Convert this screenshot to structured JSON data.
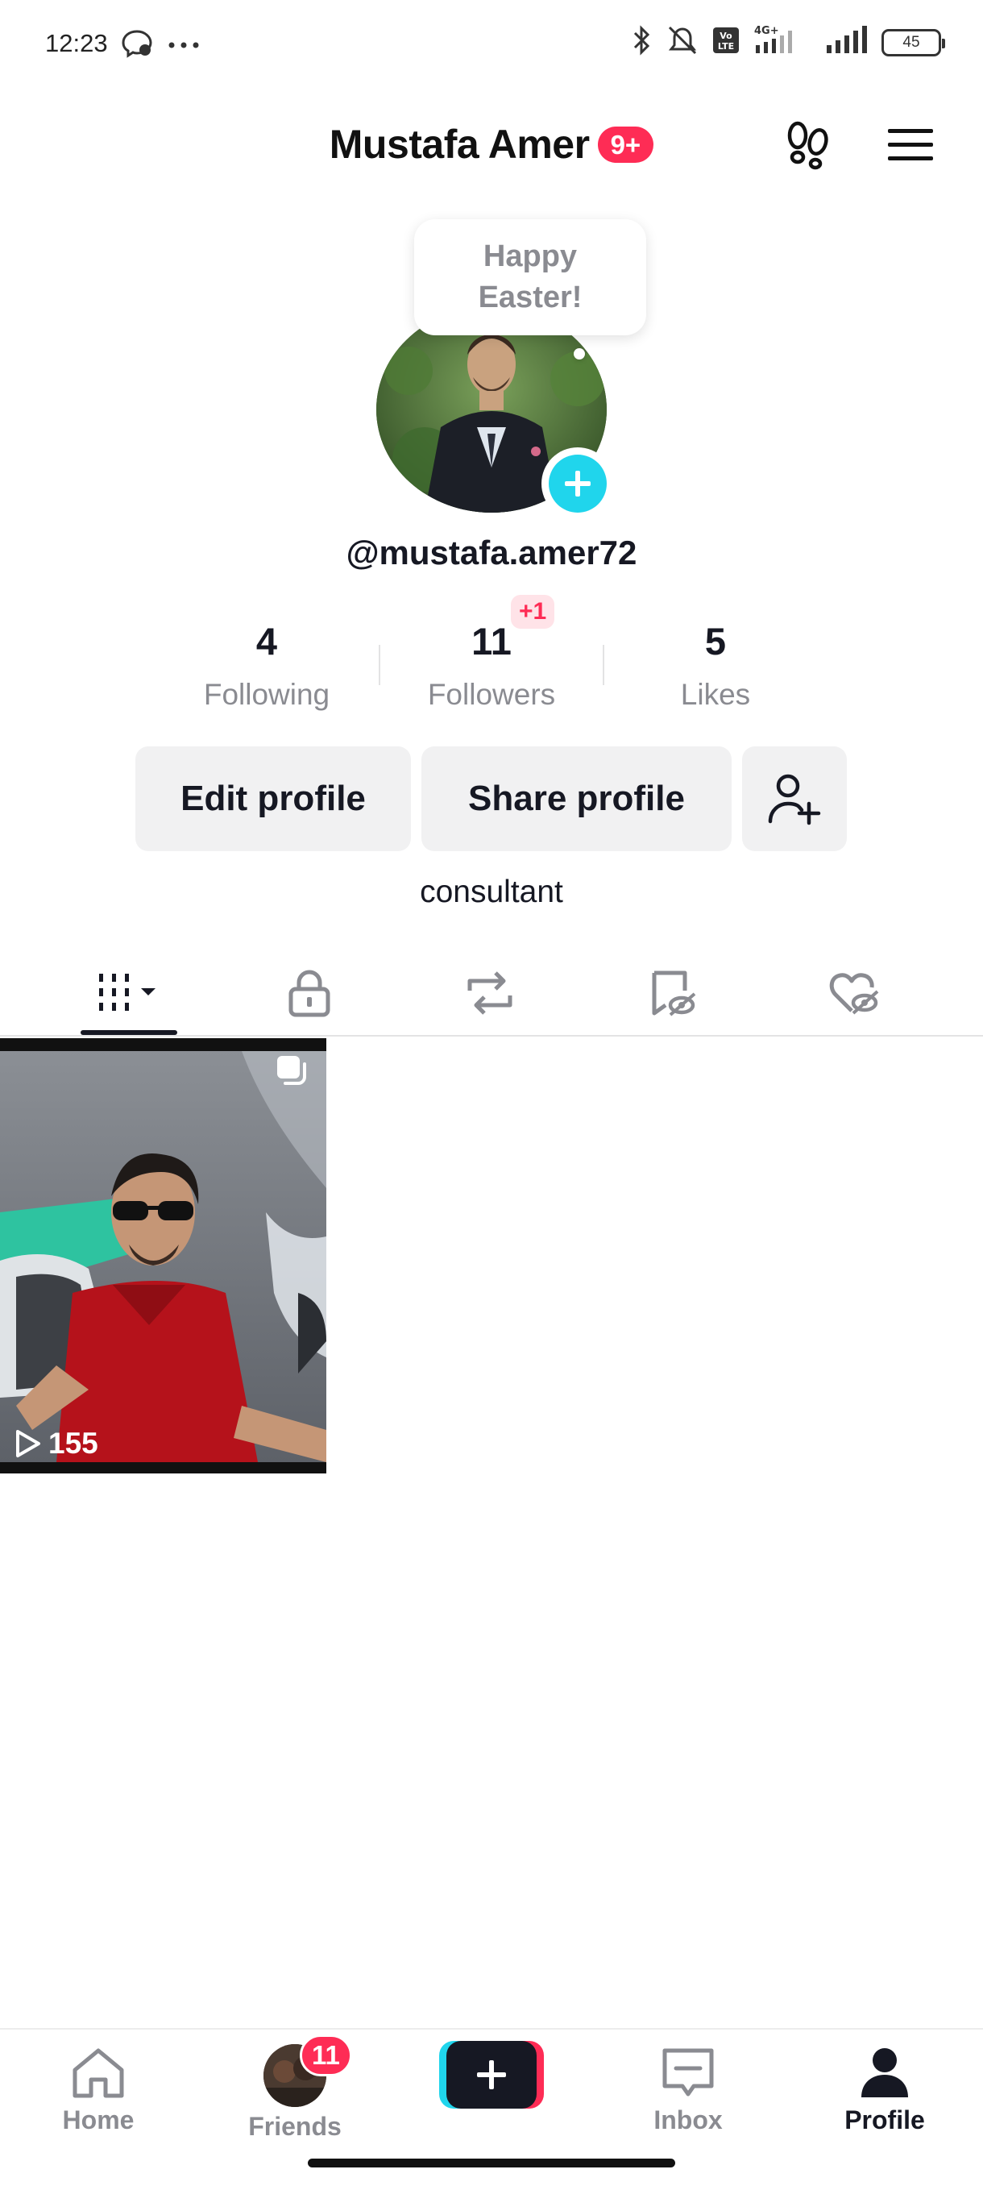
{
  "status_bar": {
    "time": "12:23",
    "battery": "45",
    "network": "4G+"
  },
  "header": {
    "name": "Mustafa Amer",
    "notification_badge": "9+"
  },
  "profile": {
    "bubble_text": "Happy Easter!",
    "username": "@mustafa.amer72",
    "bio": "consultant"
  },
  "stats": [
    {
      "value": "4",
      "label": "Following"
    },
    {
      "value": "11",
      "label": "Followers",
      "badge": "+1"
    },
    {
      "value": "5",
      "label": "Likes"
    }
  ],
  "buttons": {
    "edit": "Edit profile",
    "share": "Share profile"
  },
  "tabs": [
    {
      "icon": "grid-icon",
      "active": true
    },
    {
      "icon": "lock-icon"
    },
    {
      "icon": "repost-icon"
    },
    {
      "icon": "bookmark-hidden-icon"
    },
    {
      "icon": "liked-hidden-icon"
    }
  ],
  "videos": [
    {
      "views": "155"
    }
  ],
  "bottom_nav": {
    "home": "Home",
    "friends": "Friends",
    "friends_badge": "11",
    "inbox": "Inbox",
    "profile": "Profile"
  },
  "colors": {
    "accent": "#fe2c55",
    "cyan": "#20d5ec",
    "text": "#161823",
    "muted": "#8a8b91"
  }
}
